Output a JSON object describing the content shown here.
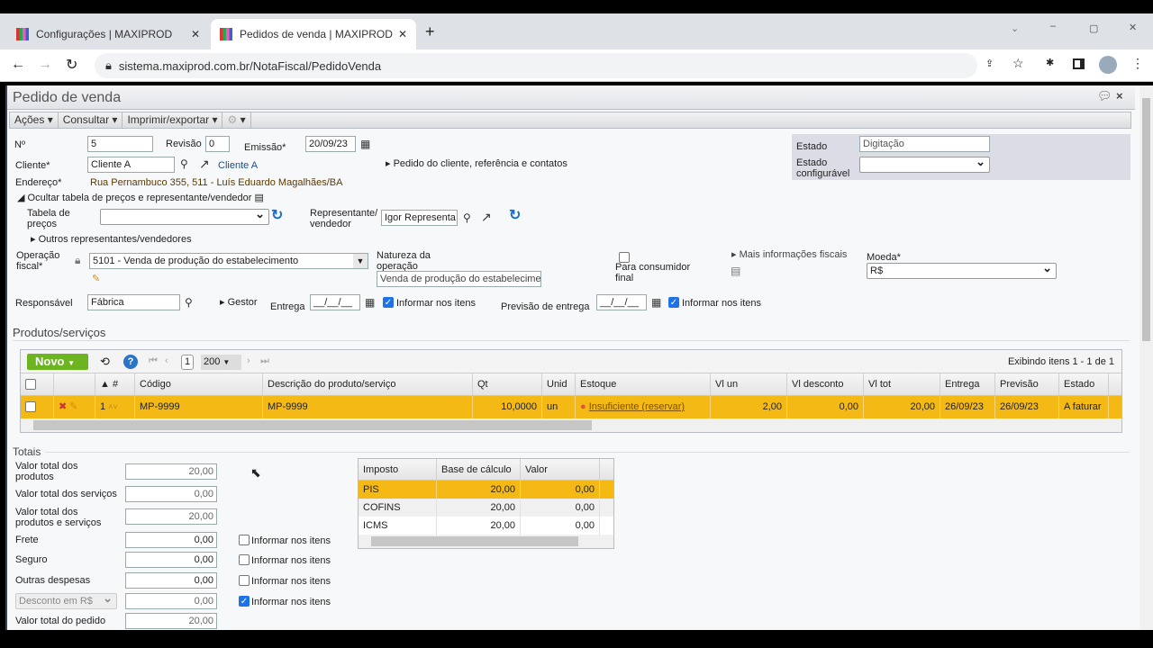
{
  "browser": {
    "tabs": [
      {
        "label": "Configurações | MAXIPROD"
      },
      {
        "label": "Pedidos de venda | MAXIPROD"
      }
    ],
    "url": "sistema.maxiprod.com.br/NotaFiscal/PedidoVenda"
  },
  "window": {
    "title": "Pedido de venda"
  },
  "toolbar": {
    "acoes": "Ações",
    "consultar": "Consultar",
    "imprimir": "Imprimir/exportar"
  },
  "form": {
    "numero_label": "Nº",
    "numero": "5",
    "revisao_label": "Revisão",
    "revisao": "0",
    "emissao_label": "Emissão*",
    "emissao": "20/09/23",
    "estado_label": "Estado",
    "estado": "Digitação",
    "estado_config_label": "Estado configurável",
    "estado_config": "",
    "cliente_label": "Cliente*",
    "cliente": "Cliente A",
    "cliente_link": "Cliente A",
    "pedido_cliente": "Pedido do cliente, referência e contatos",
    "endereco_label": "Endereço*",
    "endereco": "Rua Pernambuco 355, 511 - Luís Eduardo Magalhães/BA",
    "ocultar": "Ocultar tabela de preços e representante/vendedor",
    "tabela_label": "Tabela de preços",
    "tabela": "",
    "representante_label": "Representante/ vendedor",
    "representante": "Igor Representa",
    "outros": "Outros representantes/vendedores",
    "operacao_label": "Operação fiscal*",
    "operacao": "5101 - Venda de produção do estabelecimento",
    "natureza_label": "Natureza da operação",
    "natureza": "Venda de produção do estabelecimento",
    "consumidor_label": "Para consumidor final",
    "mais_info": "Mais informações fiscais",
    "moeda_label": "Moeda*",
    "moeda": "R$",
    "responsavel_label": "Responsável",
    "responsavel": "Fábrica",
    "gestor": "Gestor",
    "entrega_label": "Entrega",
    "entrega": "__/__/__",
    "informar": "Informar nos itens",
    "previsao_label": "Previsão de entrega",
    "previsao": "__/__/__"
  },
  "produtos": {
    "title": "Produtos/serviços",
    "novo": "Novo",
    "page": "1",
    "page_size": "200",
    "exibindo": "Exibindo itens 1 - 1 de 1",
    "columns": [
      "#",
      "Código",
      "Descrição do produto/serviço",
      "Qt",
      "Unid",
      "Estoque",
      "Vl un",
      "Vl desconto",
      "Vl tot",
      "Entrega",
      "Previsão",
      "Estado"
    ],
    "rows": [
      {
        "n": "1",
        "codigo": "MP-9999",
        "descricao": "MP-9999",
        "qt": "10,0000",
        "unid": "un",
        "estoque": "Insuficiente (reservar)",
        "vl_un": "2,00",
        "vl_desc": "0,00",
        "vl_tot": "20,00",
        "entrega": "26/09/23",
        "previsao": "26/09/23",
        "estado": "A faturar"
      }
    ]
  },
  "totais": {
    "title": "Totais",
    "produtos_label": "Valor total dos produtos",
    "produtos": "20,00",
    "servicos_label": "Valor total dos serviços",
    "servicos": "0,00",
    "prod_serv_label": "Valor total dos produtos e serviços",
    "prod_serv": "20,00",
    "frete_label": "Frete",
    "frete": "0,00",
    "seguro_label": "Seguro",
    "seguro": "0,00",
    "outras_label": "Outras despesas",
    "outras": "0,00",
    "desconto_tipo": "Desconto em R$",
    "desconto": "0,00",
    "pedido_label": "Valor total do pedido",
    "pedido": "20,00",
    "informar": "Informar nos itens"
  },
  "impostos": {
    "columns": [
      "Imposto",
      "Base de cálculo",
      "Valor"
    ],
    "rows": [
      {
        "imposto": "PIS",
        "base": "20,00",
        "valor": "0,00"
      },
      {
        "imposto": "COFINS",
        "base": "20,00",
        "valor": "0,00"
      },
      {
        "imposto": "ICMS",
        "base": "20,00",
        "valor": "0,00"
      }
    ]
  },
  "colors": {
    "accent": "#1e73e8",
    "row_selected": "#f5b916",
    "novo": "#6cb521"
  }
}
